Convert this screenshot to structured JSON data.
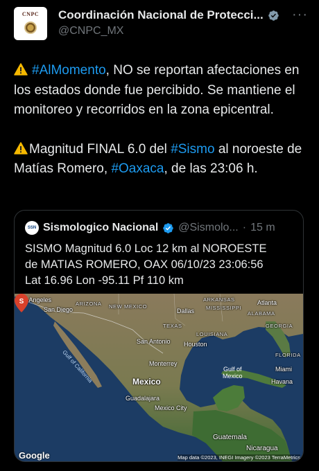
{
  "author": {
    "display_name": "Coordinación Nacional de Protecci...",
    "handle": "@CNPC_MX",
    "avatar_text": "CNPC"
  },
  "tweet": {
    "p1_link": "#AlMomento",
    "p1_text": ", NO se reportan afectaciones en los estados donde fue percibido. Se mantiene el monitoreo y recorridos en la zona epicentral.",
    "p2_a": "Magnitud FINAL 6.0 del ",
    "p2_link1": "#Sismo",
    "p2_b": " al noroeste de Matías Romero, ",
    "p2_link2": "#Oaxaca",
    "p2_c": ", de las 23:06 h."
  },
  "quote": {
    "avatar_text": "SSN",
    "name": "Sismologico Nacional",
    "handle": "@Sismolo...",
    "dot": "·",
    "time": "15 m",
    "text": "SISMO Magnitud 6.0 Loc  12 km al NOROESTE\nde MATIAS ROMERO, OAX 06/10/23 23:06:56\nLat 16.96 Lon -95.11 Pf 110 km"
  },
  "map": {
    "labels": {
      "los_angeles": "Los Angeles",
      "san_diego": "San Diego",
      "arizona": "ARIZONA",
      "new_mexico": "NEW MEXICO",
      "arkansas": "ARKANSAS",
      "mississippi": "MISSISSIPPI",
      "atlanta": "Atlanta",
      "alabama": "ALABAMA",
      "dallas": "Dallas",
      "georgia": "GEORGIA",
      "texas": "TEXAS",
      "louisiana": "LOUISIANA",
      "gulf_california": "Gulf of California",
      "san_antonio": "San Antonio",
      "houston": "Houston",
      "florida": "FLORIDA",
      "monterrey": "Monterrey",
      "gulf_mexico": "Gulf of\nMexico",
      "miami": "Miami",
      "mexico": "Mexico",
      "havana": "Havana",
      "guadalajara": "Guadalajara",
      "mexico_city": "Mexico City",
      "guatemala": "Guatemala",
      "nicaragua": "Nicaragua"
    },
    "pin_letter": "S",
    "google": "Google",
    "attribution": "Map data ©2023, INEGI Imagery ©2023 TerraMetrics"
  }
}
